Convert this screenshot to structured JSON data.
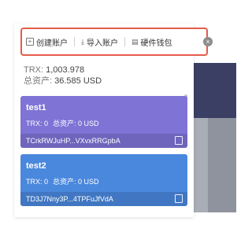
{
  "toolbar": {
    "create_label": "创建账户",
    "import_label": "导入账户",
    "hardware_label": "硬件钱包"
  },
  "summary": {
    "trx_label": "TRX:",
    "trx_value": "1,003.978",
    "assets_label": "总资产:",
    "assets_value": "36.585 USD"
  },
  "accounts": [
    {
      "name": "test1",
      "trx": "TRX: 0",
      "assets": "总资产: 0 USD",
      "address": "TCrkRWJuHP...VXvxRRGpbA",
      "color": "#7f73d6"
    },
    {
      "name": "test2",
      "trx": "TRX: 0",
      "assets": "总资产: 0 USD",
      "address": "TD3J7Nny3P...4TPFuJfVdA",
      "color": "#4a88dd"
    }
  ],
  "colors": {
    "highlight_border": "#e45b4a"
  }
}
